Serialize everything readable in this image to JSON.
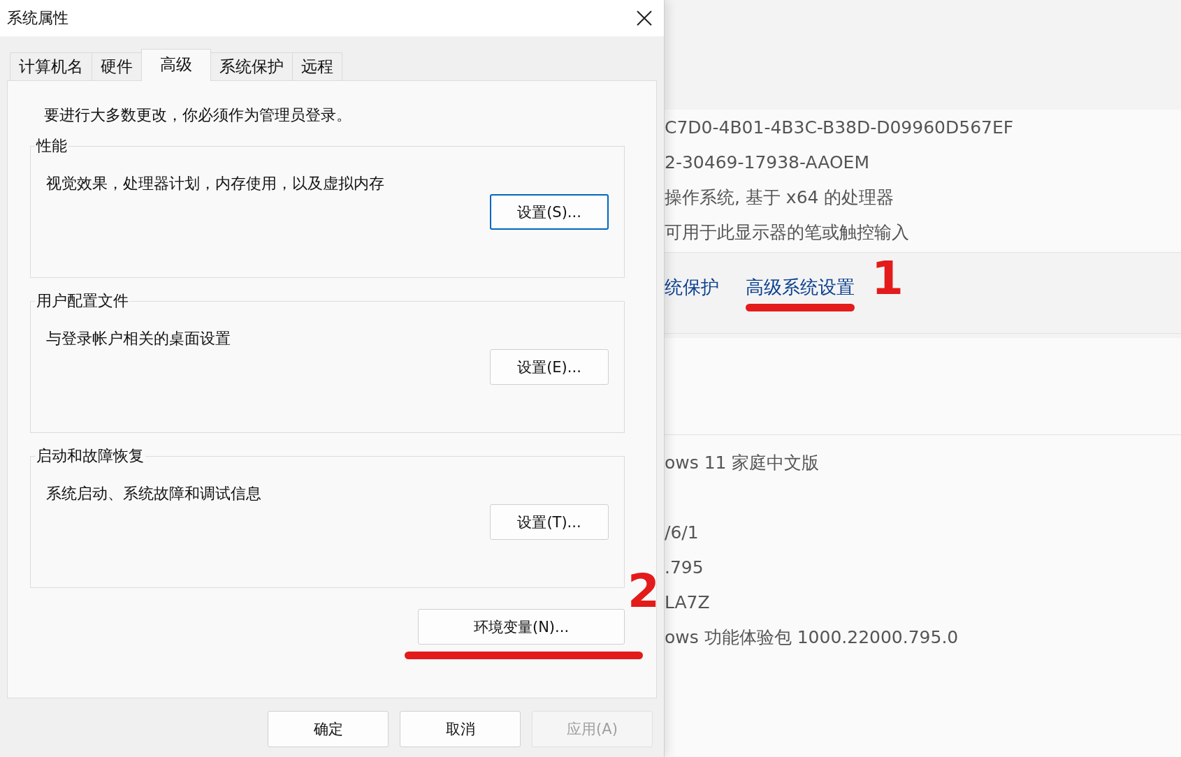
{
  "window": {
    "title": "系统属性"
  },
  "tabs": [
    {
      "label": "计算机名",
      "selected": false
    },
    {
      "label": "硬件",
      "selected": false
    },
    {
      "label": "高级",
      "selected": true
    },
    {
      "label": "系统保护",
      "selected": false
    },
    {
      "label": "远程",
      "selected": false
    }
  ],
  "notice": "要进行大多数更改，你必须作为管理员登录。",
  "groups": [
    {
      "title": "性能",
      "description": "视觉效果，处理器计划，内存使用，以及虚拟内存",
      "button": "设置(S)...",
      "focused": true
    },
    {
      "title": "用户配置文件",
      "description": "与登录帐户相关的桌面设置",
      "button": "设置(E)...",
      "focused": false
    },
    {
      "title": "启动和故障恢复",
      "description": "系统启动、系统故障和调试信息",
      "button": "设置(T)...",
      "focused": false
    }
  ],
  "env_button": {
    "label": "环境变量(N)...",
    "marked": true,
    "mark": "2"
  },
  "buttons": [
    {
      "label": "确定",
      "disabled": false
    },
    {
      "label": "取消",
      "disabled": false
    },
    {
      "label": "应用(A)",
      "disabled": true
    }
  ],
  "background_window": {
    "spec_rows": [
      "C7D0-4B01-4B3C-B38D-D09960D567EF",
      "2-30469-17938-AAOEM",
      "操作系统, 基于 x64 的处理器",
      "可用于此显示器的笔或触控输入"
    ],
    "links": [
      {
        "text": "统保护",
        "marked": false
      },
      {
        "text": "高级系统设置",
        "marked": true,
        "mark": "1"
      }
    ],
    "windows_rows": [
      "ows 11 家庭中文版",
      "/6/1",
      ".795",
      "LA7Z",
      "ows 功能体验包 1000.22000.795.0"
    ]
  }
}
